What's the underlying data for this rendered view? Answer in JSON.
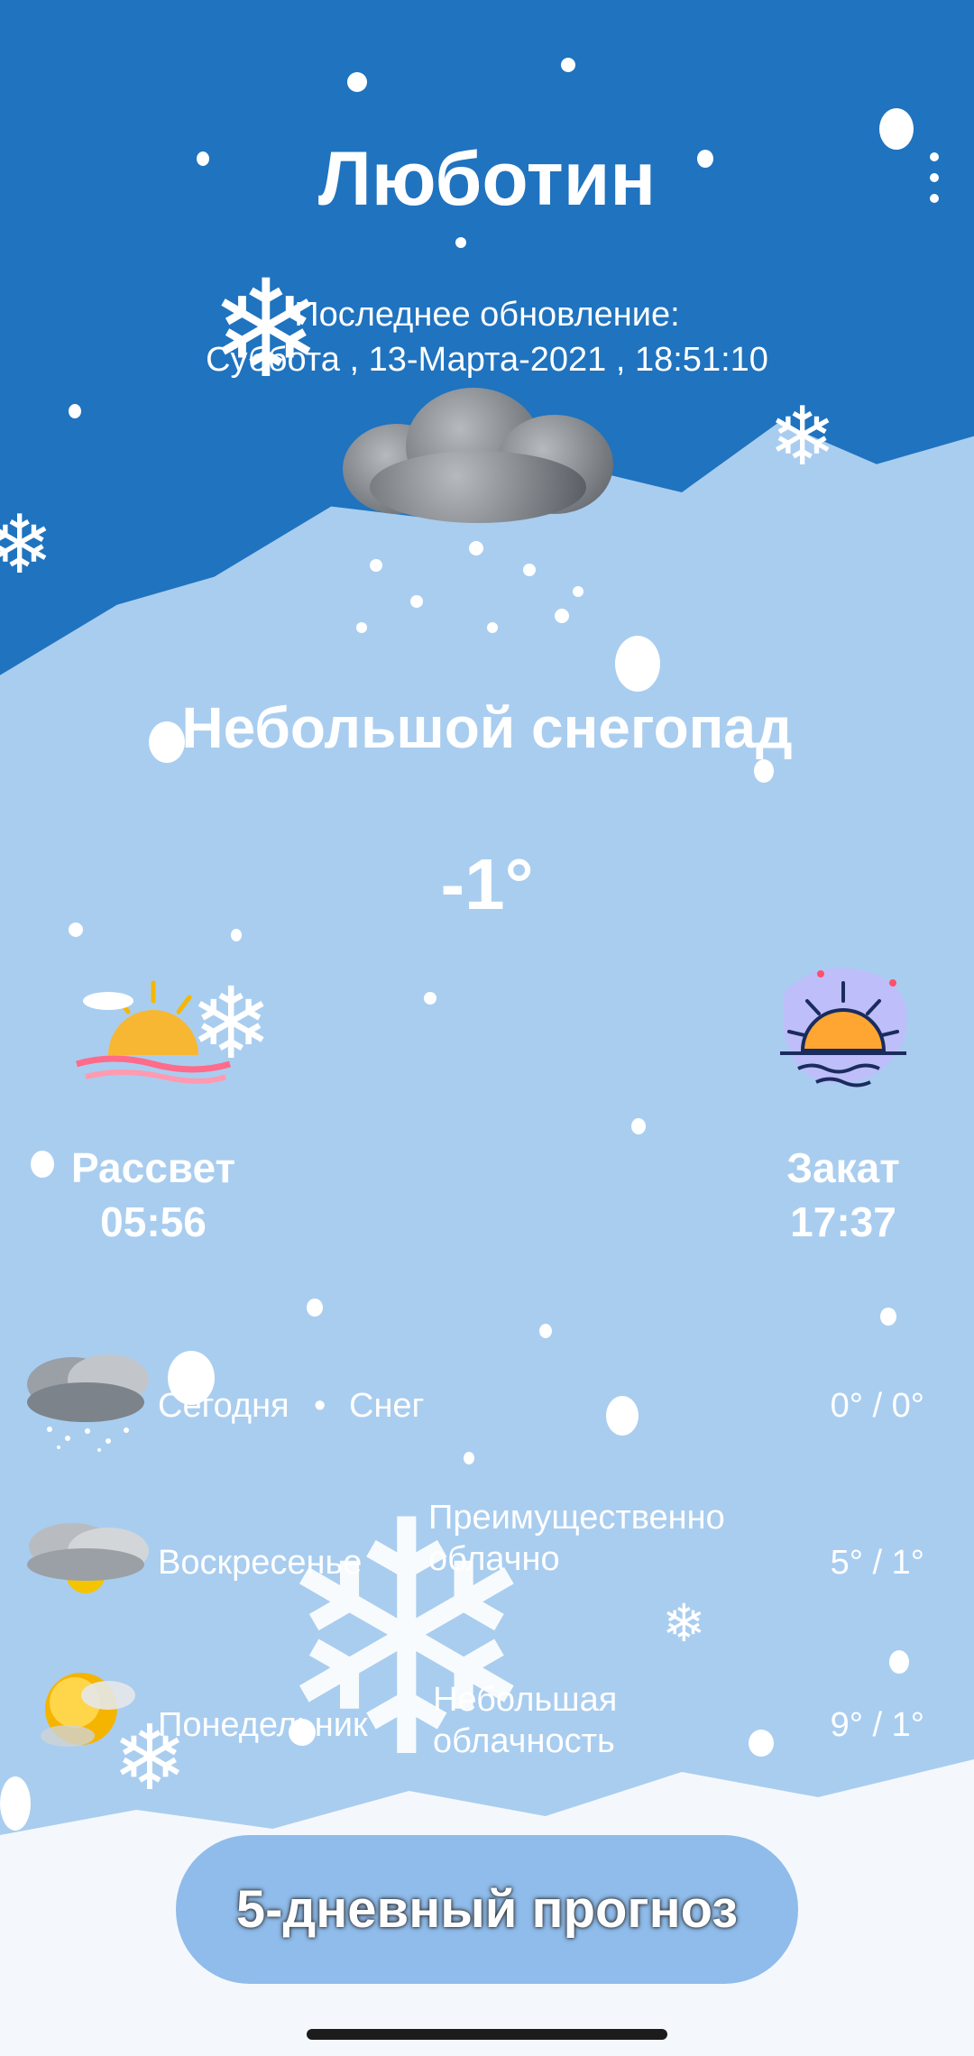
{
  "city": "Люботин",
  "last_update_label": "Последнее обновление:",
  "last_update_value": "Суббота , 13-Марта-2021 , 18:51:10",
  "condition": "Небольшой снегопад",
  "temperature": "-1°",
  "sunrise": {
    "label": "Рассвет",
    "time": "05:56",
    "icon": "sunrise-icon"
  },
  "sunset": {
    "label": "Закат",
    "time": "17:37",
    "icon": "sunset-icon"
  },
  "forecast": [
    {
      "day": "Сегодня",
      "separator": "•",
      "condition": "Снег",
      "temp": "0° / 0°",
      "icon": "snow-cloud-icon"
    },
    {
      "day": "Воскресенье",
      "separator": "",
      "condition": "Преимущественно облачно",
      "temp": "5° / 1°",
      "icon": "cloudy-sun-icon"
    },
    {
      "day": "Понедельник",
      "separator": "",
      "condition": "Небольшая облачность",
      "temp": "9° / 1°",
      "icon": "partly-sunny-icon"
    }
  ],
  "forecast_button": "5-дневный прогноз",
  "colors": {
    "sky_top": "#1f73bf",
    "sky_bottom": "#a9cdef",
    "button": "#8fbceb"
  }
}
